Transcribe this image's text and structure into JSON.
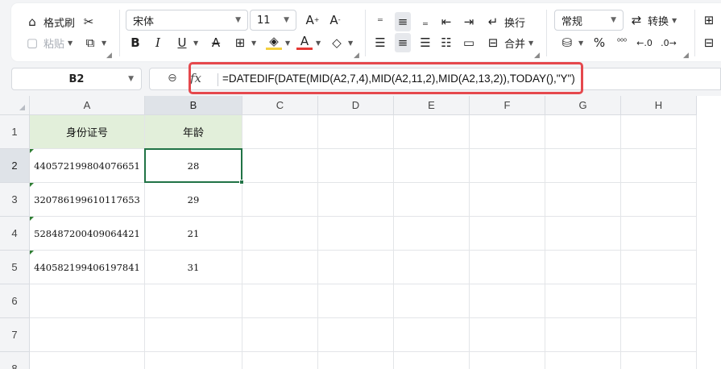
{
  "ribbon": {
    "format_painter": "格式刷",
    "paste": "粘贴",
    "font_name": "宋体",
    "font_size": "11",
    "wrap": "换行",
    "merge": "合并",
    "number_format": "常规",
    "convert": "转换",
    "bold": "B",
    "italic": "I",
    "underline": "U",
    "percent": "%",
    "dec_inc": "⁺⁰⁰",
    "dec_dec": "⁰⁰",
    "cut_icon": "scissors-icon",
    "copy_icon": "copy-icon",
    "increase_font_icon": "font-increase-icon",
    "decrease_font_icon": "font-decrease-icon"
  },
  "formula_bar": {
    "name_box": "B2",
    "fx": "fx",
    "formula": "=DATEDIF(DATE(MID(A2,7,4),MID(A2,11,2),MID(A2,13,2)),TODAY(),\"Y\")"
  },
  "columns": [
    "A",
    "B",
    "C",
    "D",
    "E",
    "F",
    "G",
    "H"
  ],
  "rows": [
    "1",
    "2",
    "3",
    "4",
    "5",
    "6",
    "7",
    "8"
  ],
  "table": {
    "header": [
      "身份证号",
      "年龄"
    ],
    "data": [
      [
        "440572199804076651",
        "28"
      ],
      [
        "320786199610117653",
        "29"
      ],
      [
        "528487200409064421",
        "21"
      ],
      [
        "440582199406197841",
        "31"
      ]
    ]
  },
  "colors": {
    "header_fill": "#e2efda",
    "selection": "#217346",
    "highlight_box": "#e5484d"
  }
}
